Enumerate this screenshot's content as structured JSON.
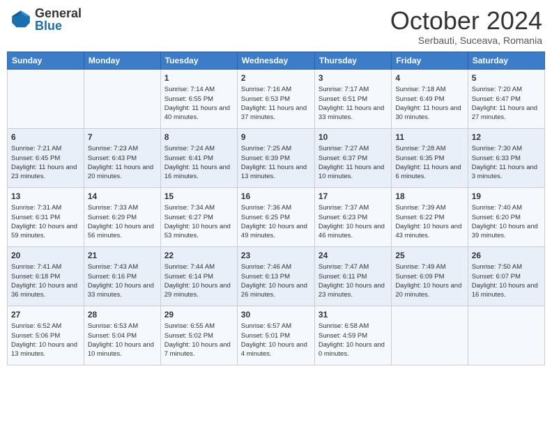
{
  "header": {
    "logo_general": "General",
    "logo_blue": "Blue",
    "month": "October 2024",
    "location": "Serbauti, Suceava, Romania"
  },
  "weekdays": [
    "Sunday",
    "Monday",
    "Tuesday",
    "Wednesday",
    "Thursday",
    "Friday",
    "Saturday"
  ],
  "weeks": [
    [
      {
        "day": "",
        "info": ""
      },
      {
        "day": "",
        "info": ""
      },
      {
        "day": "1",
        "info": "Sunrise: 7:14 AM\nSunset: 6:55 PM\nDaylight: 11 hours and 40 minutes."
      },
      {
        "day": "2",
        "info": "Sunrise: 7:16 AM\nSunset: 6:53 PM\nDaylight: 11 hours and 37 minutes."
      },
      {
        "day": "3",
        "info": "Sunrise: 7:17 AM\nSunset: 6:51 PM\nDaylight: 11 hours and 33 minutes."
      },
      {
        "day": "4",
        "info": "Sunrise: 7:18 AM\nSunset: 6:49 PM\nDaylight: 11 hours and 30 minutes."
      },
      {
        "day": "5",
        "info": "Sunrise: 7:20 AM\nSunset: 6:47 PM\nDaylight: 11 hours and 27 minutes."
      }
    ],
    [
      {
        "day": "6",
        "info": "Sunrise: 7:21 AM\nSunset: 6:45 PM\nDaylight: 11 hours and 23 minutes."
      },
      {
        "day": "7",
        "info": "Sunrise: 7:23 AM\nSunset: 6:43 PM\nDaylight: 11 hours and 20 minutes."
      },
      {
        "day": "8",
        "info": "Sunrise: 7:24 AM\nSunset: 6:41 PM\nDaylight: 11 hours and 16 minutes."
      },
      {
        "day": "9",
        "info": "Sunrise: 7:25 AM\nSunset: 6:39 PM\nDaylight: 11 hours and 13 minutes."
      },
      {
        "day": "10",
        "info": "Sunrise: 7:27 AM\nSunset: 6:37 PM\nDaylight: 11 hours and 10 minutes."
      },
      {
        "day": "11",
        "info": "Sunrise: 7:28 AM\nSunset: 6:35 PM\nDaylight: 11 hours and 6 minutes."
      },
      {
        "day": "12",
        "info": "Sunrise: 7:30 AM\nSunset: 6:33 PM\nDaylight: 11 hours and 3 minutes."
      }
    ],
    [
      {
        "day": "13",
        "info": "Sunrise: 7:31 AM\nSunset: 6:31 PM\nDaylight: 10 hours and 59 minutes."
      },
      {
        "day": "14",
        "info": "Sunrise: 7:33 AM\nSunset: 6:29 PM\nDaylight: 10 hours and 56 minutes."
      },
      {
        "day": "15",
        "info": "Sunrise: 7:34 AM\nSunset: 6:27 PM\nDaylight: 10 hours and 53 minutes."
      },
      {
        "day": "16",
        "info": "Sunrise: 7:36 AM\nSunset: 6:25 PM\nDaylight: 10 hours and 49 minutes."
      },
      {
        "day": "17",
        "info": "Sunrise: 7:37 AM\nSunset: 6:23 PM\nDaylight: 10 hours and 46 minutes."
      },
      {
        "day": "18",
        "info": "Sunrise: 7:39 AM\nSunset: 6:22 PM\nDaylight: 10 hours and 43 minutes."
      },
      {
        "day": "19",
        "info": "Sunrise: 7:40 AM\nSunset: 6:20 PM\nDaylight: 10 hours and 39 minutes."
      }
    ],
    [
      {
        "day": "20",
        "info": "Sunrise: 7:41 AM\nSunset: 6:18 PM\nDaylight: 10 hours and 36 minutes."
      },
      {
        "day": "21",
        "info": "Sunrise: 7:43 AM\nSunset: 6:16 PM\nDaylight: 10 hours and 33 minutes."
      },
      {
        "day": "22",
        "info": "Sunrise: 7:44 AM\nSunset: 6:14 PM\nDaylight: 10 hours and 29 minutes."
      },
      {
        "day": "23",
        "info": "Sunrise: 7:46 AM\nSunset: 6:13 PM\nDaylight: 10 hours and 26 minutes."
      },
      {
        "day": "24",
        "info": "Sunrise: 7:47 AM\nSunset: 6:11 PM\nDaylight: 10 hours and 23 minutes."
      },
      {
        "day": "25",
        "info": "Sunrise: 7:49 AM\nSunset: 6:09 PM\nDaylight: 10 hours and 20 minutes."
      },
      {
        "day": "26",
        "info": "Sunrise: 7:50 AM\nSunset: 6:07 PM\nDaylight: 10 hours and 16 minutes."
      }
    ],
    [
      {
        "day": "27",
        "info": "Sunrise: 6:52 AM\nSunset: 5:06 PM\nDaylight: 10 hours and 13 minutes."
      },
      {
        "day": "28",
        "info": "Sunrise: 6:53 AM\nSunset: 5:04 PM\nDaylight: 10 hours and 10 minutes."
      },
      {
        "day": "29",
        "info": "Sunrise: 6:55 AM\nSunset: 5:02 PM\nDaylight: 10 hours and 7 minutes."
      },
      {
        "day": "30",
        "info": "Sunrise: 6:57 AM\nSunset: 5:01 PM\nDaylight: 10 hours and 4 minutes."
      },
      {
        "day": "31",
        "info": "Sunrise: 6:58 AM\nSunset: 4:59 PM\nDaylight: 10 hours and 0 minutes."
      },
      {
        "day": "",
        "info": ""
      },
      {
        "day": "",
        "info": ""
      }
    ]
  ]
}
